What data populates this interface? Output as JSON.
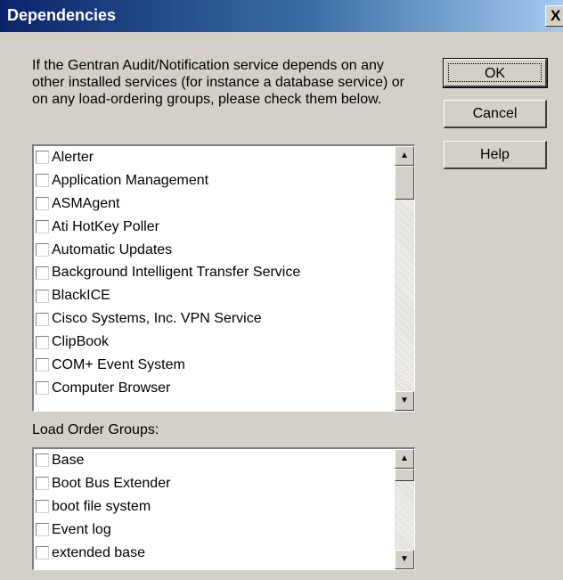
{
  "window": {
    "title": "Dependencies",
    "close_glyph": "X"
  },
  "description": "If the Gentran Audit/Notification service depends on any other installed services (for instance a database service) or on any load-ordering groups, please check them below.",
  "buttons": {
    "ok": "OK",
    "cancel": "Cancel",
    "help": "Help"
  },
  "services": {
    "items": [
      {
        "label": "Alerter",
        "checked": false
      },
      {
        "label": "Application Management",
        "checked": false
      },
      {
        "label": "ASMAgent",
        "checked": false
      },
      {
        "label": "Ati HotKey Poller",
        "checked": false
      },
      {
        "label": "Automatic Updates",
        "checked": false
      },
      {
        "label": "Background Intelligent Transfer Service",
        "checked": false
      },
      {
        "label": "BlackICE",
        "checked": false
      },
      {
        "label": "Cisco Systems, Inc. VPN Service",
        "checked": false
      },
      {
        "label": "ClipBook",
        "checked": false
      },
      {
        "label": "COM+ Event System",
        "checked": false
      },
      {
        "label": "Computer Browser",
        "checked": false
      }
    ]
  },
  "load_order_groups": {
    "label": "Load Order Groups:",
    "items": [
      {
        "label": "Base",
        "checked": false
      },
      {
        "label": "Boot Bus Extender",
        "checked": false
      },
      {
        "label": "boot file system",
        "checked": false
      },
      {
        "label": "Event log",
        "checked": false
      },
      {
        "label": "extended base",
        "checked": false
      }
    ]
  },
  "icons": {
    "scroll_up": "▲",
    "scroll_down": "▼"
  }
}
